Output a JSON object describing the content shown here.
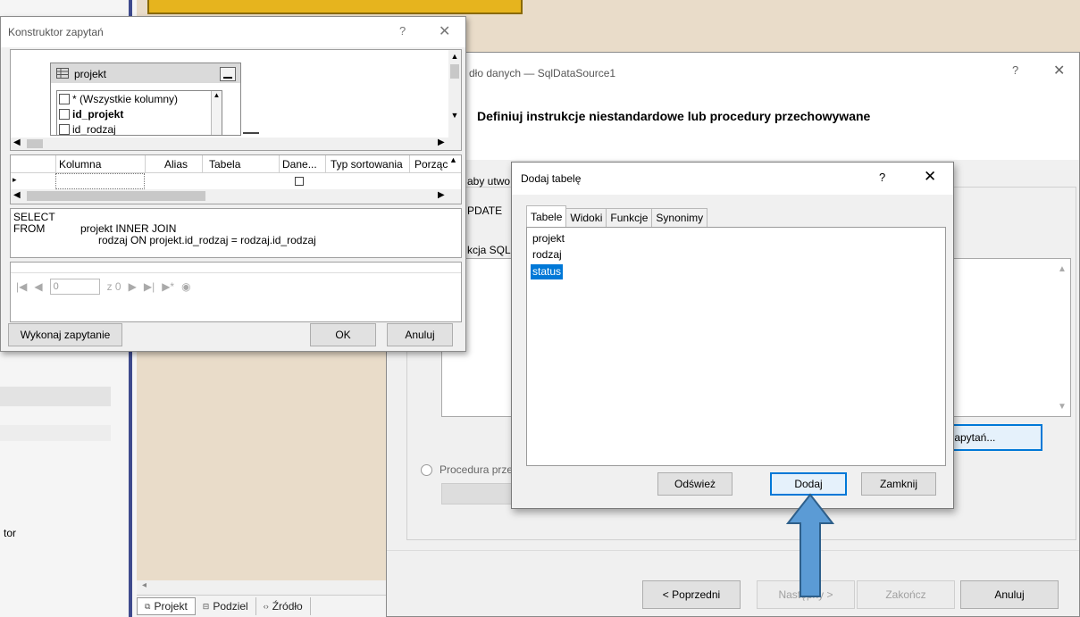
{
  "ide": {
    "left_panel_text": "tor",
    "bottom_tabs": [
      {
        "label": "Projekt",
        "icon": "project-view-icon"
      },
      {
        "label": "Podziel",
        "icon": "split-view-icon"
      },
      {
        "label": "Źródło",
        "icon": "source-view-icon"
      }
    ]
  },
  "wizard": {
    "title": "dło danych — SqlDataSource1",
    "help": "?",
    "close": "✕",
    "heading": "Definiuj instrukcje niestandardowe lub procedury przechowywane",
    "aby_text": "aby utwo",
    "tab_update": "PDATE",
    "sql_label": "kcja SQL:",
    "query_builder_button": "r zapytań...",
    "procedure_label": "Procedura prze",
    "buttons": {
      "previous": "< Poprzedni",
      "next": "Następny >",
      "finish": "Zakończ",
      "cancel": "Anuluj"
    }
  },
  "query_builder": {
    "title": "Konstruktor zapytań",
    "help": "?",
    "close": "✕",
    "table": {
      "name": "projekt",
      "columns": [
        {
          "label": "* (Wszystkie kolumny)",
          "bold": false
        },
        {
          "label": "id_projekt",
          "bold": true
        },
        {
          "label": "id_rodzaj",
          "bold": false
        }
      ]
    },
    "grid_headers": [
      "Kolumna",
      "Alias",
      "Tabela",
      "Dane...",
      "Typ sortowania",
      "Porząc"
    ],
    "sql_text": {
      "line1_kw": "SELECT",
      "line2_kw": "FROM",
      "line2_rest": "projekt INNER JOIN",
      "line3": "rodzaj ON projekt.id_rodzaj = rodzaj.id_rodzaj"
    },
    "nav": {
      "position": "0",
      "of_text": "z 0"
    },
    "buttons": {
      "execute": "Wykonaj zapytanie",
      "ok": "OK",
      "cancel": "Anuluj"
    }
  },
  "add_table": {
    "title": "Dodaj tabelę",
    "help": "?",
    "close": "✕",
    "tabs": [
      "Tabele",
      "Widoki",
      "Funkcje",
      "Synonimy"
    ],
    "active_tab": "Tabele",
    "items": [
      "projekt",
      "rodzaj",
      "status"
    ],
    "selected_item": "status",
    "buttons": {
      "refresh": "Odśwież",
      "add": "Dodaj",
      "close": "Zamknij"
    }
  },
  "colors": {
    "selection": "#0078d7",
    "arrow_fill": "#5b9bd5",
    "arrow_stroke": "#2e5f8a",
    "ide_accent": "#3e4a8d"
  }
}
